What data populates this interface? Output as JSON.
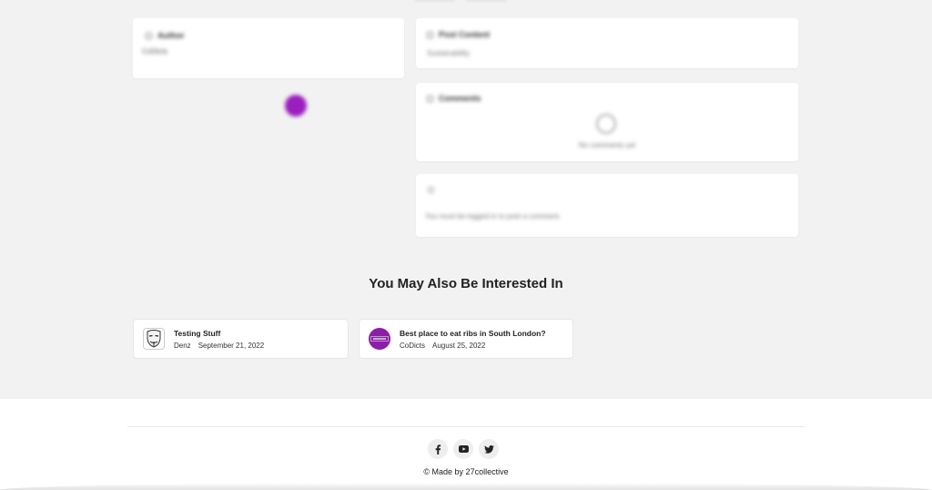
{
  "post": {
    "author_heading": "Author",
    "author_name": "CoDicts",
    "post_content_heading": "Post Content",
    "post_content_text": "Sustainability",
    "comments_heading": "Comments",
    "no_comments_text": "No comments yet",
    "login_notice": "You must be logged in to post a comment."
  },
  "related": {
    "title": "You May Also Be Interested In",
    "items": [
      {
        "title": "Testing Stuff",
        "author": "Denz",
        "date": "September 21, 2022",
        "thumb": "mask-icon"
      },
      {
        "title": "Best place to eat ribs in South London?",
        "author": "CoDicts",
        "date": "August 25, 2022",
        "thumb": "codicts-logo"
      }
    ]
  },
  "footer": {
    "socials": [
      "facebook-icon",
      "youtube-icon",
      "twitter-icon"
    ],
    "copyright": "© Made by 27collective"
  },
  "colors": {
    "brand_purple": "#9b1fc0",
    "background": "#f2f2f2"
  }
}
